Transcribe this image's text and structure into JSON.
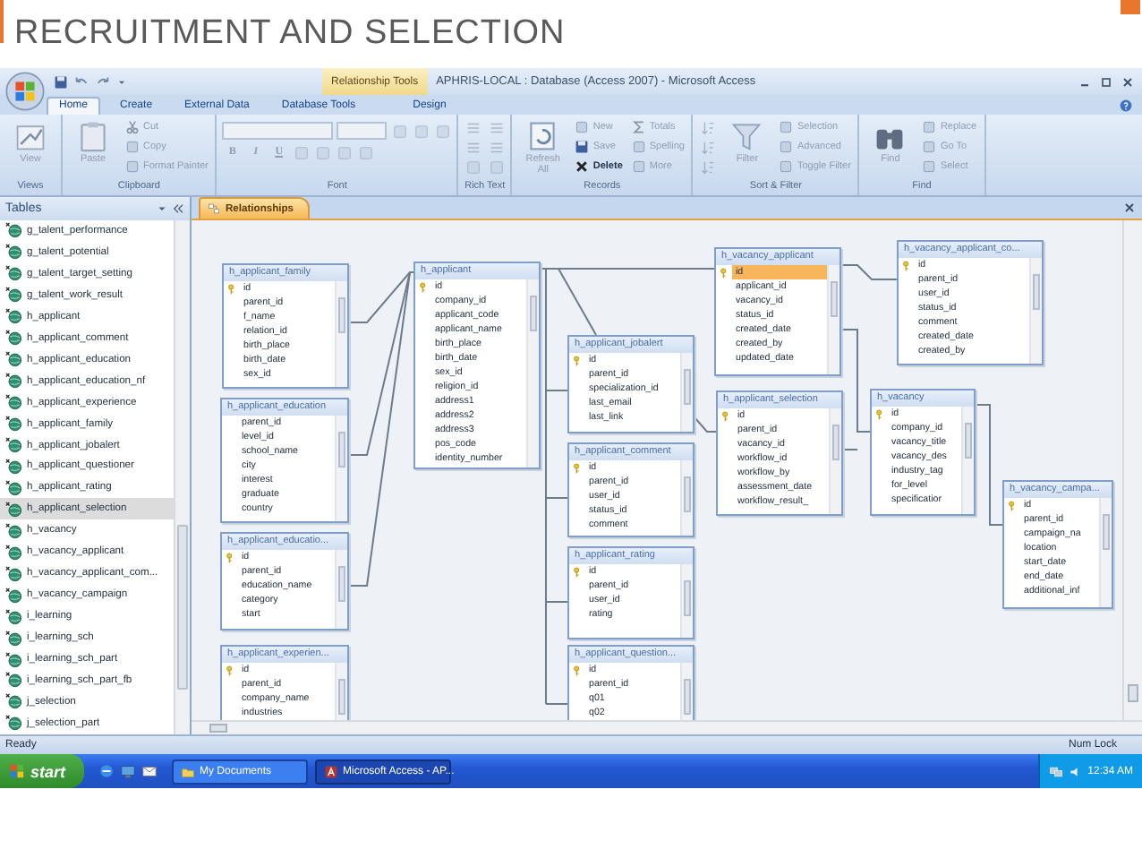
{
  "slide_title": "RECRUITMENT AND SELECTION",
  "window": {
    "context_tab": "Relationship Tools",
    "title": "APHRIS-LOCAL : Database (Access 2007) - Microsoft Access"
  },
  "ribbon_tabs": [
    {
      "label": "Home",
      "selected": true
    },
    {
      "label": "Create",
      "selected": false
    },
    {
      "label": "External Data",
      "selected": false
    },
    {
      "label": "Database Tools",
      "selected": false
    },
    {
      "label": "Design",
      "selected": false
    }
  ],
  "ribbon_groups": [
    {
      "label": "Views",
      "items": [
        {
          "kind": "large",
          "label": "View",
          "disabled": true
        }
      ]
    },
    {
      "label": "Clipboard",
      "items": [
        {
          "kind": "large",
          "label": "Paste",
          "disabled": true
        },
        {
          "kind": "small",
          "label": "Cut",
          "disabled": true
        },
        {
          "kind": "small",
          "label": "Copy",
          "disabled": true
        },
        {
          "kind": "small",
          "label": "Format Painter",
          "disabled": true
        }
      ]
    },
    {
      "label": "Font",
      "items": [
        {
          "kind": "field",
          "disabled": true
        },
        {
          "kind": "field",
          "disabled": true
        },
        {
          "kind": "icon",
          "disabled": true
        },
        {
          "kind": "icon",
          "disabled": true
        },
        {
          "kind": "icon",
          "disabled": true
        },
        {
          "kind": "glyph",
          "label": "B",
          "disabled": true
        },
        {
          "kind": "glyph",
          "label": "I",
          "disabled": true
        },
        {
          "kind": "glyph",
          "label": "U",
          "disabled": true
        },
        {
          "kind": "icon",
          "disabled": true
        },
        {
          "kind": "icon",
          "disabled": true
        },
        {
          "kind": "icon",
          "disabled": true
        },
        {
          "kind": "icon",
          "disabled": true
        }
      ]
    },
    {
      "label": "Rich Text",
      "items": [
        {
          "kind": "icon",
          "disabled": true
        },
        {
          "kind": "icon",
          "disabled": true
        },
        {
          "kind": "icon",
          "disabled": true
        },
        {
          "kind": "icon",
          "disabled": true
        },
        {
          "kind": "icon",
          "disabled": true
        },
        {
          "kind": "icon",
          "disabled": true
        }
      ]
    },
    {
      "label": "Records",
      "items": [
        {
          "kind": "large",
          "label": "Refresh All",
          "disabled": true
        },
        {
          "kind": "small",
          "label": "New",
          "disabled": true
        },
        {
          "kind": "small",
          "label": "Save",
          "disabled": true
        },
        {
          "kind": "small",
          "label": "Delete",
          "disabled": false
        },
        {
          "kind": "small",
          "label": "Totals",
          "disabled": true
        },
        {
          "kind": "small",
          "label": "Spelling",
          "disabled": true
        },
        {
          "kind": "small",
          "label": "More",
          "disabled": true
        }
      ]
    },
    {
      "label": "Sort & Filter",
      "items": [
        {
          "kind": "icon",
          "disabled": true
        },
        {
          "kind": "icon",
          "disabled": true
        },
        {
          "kind": "icon",
          "disabled": true
        },
        {
          "kind": "large",
          "label": "Filter",
          "disabled": true
        },
        {
          "kind": "small",
          "label": "Selection",
          "disabled": true
        },
        {
          "kind": "small",
          "label": "Advanced",
          "disabled": true
        },
        {
          "kind": "small",
          "label": "Toggle Filter",
          "disabled": true
        }
      ]
    },
    {
      "label": "Find",
      "items": [
        {
          "kind": "large",
          "label": "Find",
          "disabled": true
        },
        {
          "kind": "small",
          "label": "Replace",
          "disabled": true
        },
        {
          "kind": "small",
          "label": "Go To",
          "disabled": true
        },
        {
          "kind": "small",
          "label": "Select",
          "disabled": true
        }
      ]
    }
  ],
  "nav": {
    "header": "Tables",
    "items": [
      {
        "label": "g_talent_performance",
        "selected": false
      },
      {
        "label": "g_talent_potential",
        "selected": false
      },
      {
        "label": "g_talent_target_setting",
        "selected": false
      },
      {
        "label": "g_talent_work_result",
        "selected": false
      },
      {
        "label": "h_applicant",
        "selected": false
      },
      {
        "label": "h_applicant_comment",
        "selected": false
      },
      {
        "label": "h_applicant_education",
        "selected": false
      },
      {
        "label": "h_applicant_education_nf",
        "selected": false
      },
      {
        "label": "h_applicant_experience",
        "selected": false
      },
      {
        "label": "h_applicant_family",
        "selected": false
      },
      {
        "label": "h_applicant_jobalert",
        "selected": false
      },
      {
        "label": "h_applicant_questioner",
        "selected": false
      },
      {
        "label": "h_applicant_rating",
        "selected": false
      },
      {
        "label": "h_applicant_selection",
        "selected": true
      },
      {
        "label": "h_vacancy",
        "selected": false
      },
      {
        "label": "h_vacancy_applicant",
        "selected": false
      },
      {
        "label": "h_vacancy_applicant_com...",
        "selected": false
      },
      {
        "label": "h_vacancy_campaign",
        "selected": false
      },
      {
        "label": "i_learning",
        "selected": false
      },
      {
        "label": "i_learning_sch",
        "selected": false
      },
      {
        "label": "i_learning_sch_part",
        "selected": false
      },
      {
        "label": "i_learning_sch_part_fb",
        "selected": false
      },
      {
        "label": "j_selection",
        "selected": false
      },
      {
        "label": "j_selection_part",
        "selected": false
      }
    ]
  },
  "doc_tab": "Relationships",
  "tables": [
    {
      "title": "h_applicant_family",
      "fields": [
        {
          "name": "id",
          "key": true,
          "selected": false
        },
        {
          "name": "parent_id",
          "key": false,
          "selected": false
        },
        {
          "name": "f_name",
          "key": false,
          "selected": false
        },
        {
          "name": "relation_id",
          "key": false,
          "selected": false
        },
        {
          "name": "birth_place",
          "key": false,
          "selected": false
        },
        {
          "name": "birth_date",
          "key": false,
          "selected": false
        },
        {
          "name": "sex_id",
          "key": false,
          "selected": false
        }
      ]
    },
    {
      "title": "h_applicant_education",
      "fields": [
        {
          "name": "parent_id",
          "key": false,
          "selected": false
        },
        {
          "name": "level_id",
          "key": false,
          "selected": false
        },
        {
          "name": "school_name",
          "key": false,
          "selected": false
        },
        {
          "name": "city",
          "key": false,
          "selected": false
        },
        {
          "name": "interest",
          "key": false,
          "selected": false
        },
        {
          "name": "graduate",
          "key": false,
          "selected": false
        },
        {
          "name": "country",
          "key": false,
          "selected": false
        }
      ]
    },
    {
      "title": "h_applicant_educatio...",
      "fields": [
        {
          "name": "id",
          "key": true,
          "selected": false
        },
        {
          "name": "parent_id",
          "key": false,
          "selected": false
        },
        {
          "name": "education_name",
          "key": false,
          "selected": false
        },
        {
          "name": "category",
          "key": false,
          "selected": false
        },
        {
          "name": "start",
          "key": false,
          "selected": false
        }
      ]
    },
    {
      "title": "h_applicant_experien...",
      "fields": [
        {
          "name": "id",
          "key": true,
          "selected": false
        },
        {
          "name": "parent_id",
          "key": false,
          "selected": false
        },
        {
          "name": "company_name",
          "key": false,
          "selected": false
        },
        {
          "name": "industries",
          "key": false,
          "selected": false
        }
      ]
    },
    {
      "title": "h_applicant",
      "fields": [
        {
          "name": "id",
          "key": true,
          "selected": false
        },
        {
          "name": "company_id",
          "key": false,
          "selected": false
        },
        {
          "name": "applicant_code",
          "key": false,
          "selected": false
        },
        {
          "name": "applicant_name",
          "key": false,
          "selected": false
        },
        {
          "name": "birth_place",
          "key": false,
          "selected": false
        },
        {
          "name": "birth_date",
          "key": false,
          "selected": false
        },
        {
          "name": "sex_id",
          "key": false,
          "selected": false
        },
        {
          "name": "religion_id",
          "key": false,
          "selected": false
        },
        {
          "name": "address1",
          "key": false,
          "selected": false
        },
        {
          "name": "address2",
          "key": false,
          "selected": false
        },
        {
          "name": "address3",
          "key": false,
          "selected": false
        },
        {
          "name": "pos_code",
          "key": false,
          "selected": false
        },
        {
          "name": "identity_number",
          "key": false,
          "selected": false
        }
      ]
    },
    {
      "title": "h_applicant_jobalert",
      "fields": [
        {
          "name": "id",
          "key": true,
          "selected": false
        },
        {
          "name": "parent_id",
          "key": false,
          "selected": false
        },
        {
          "name": "specialization_id",
          "key": false,
          "selected": false
        },
        {
          "name": "last_email",
          "key": false,
          "selected": false
        },
        {
          "name": "last_link",
          "key": false,
          "selected": false
        }
      ]
    },
    {
      "title": "h_applicant_comment",
      "fields": [
        {
          "name": "id",
          "key": true,
          "selected": false
        },
        {
          "name": "parent_id",
          "key": false,
          "selected": false
        },
        {
          "name": "user_id",
          "key": false,
          "selected": false
        },
        {
          "name": "status_id",
          "key": false,
          "selected": false
        },
        {
          "name": "comment",
          "key": false,
          "selected": false
        }
      ]
    },
    {
      "title": "h_applicant_rating",
      "fields": [
        {
          "name": "id",
          "key": true,
          "selected": false
        },
        {
          "name": "parent_id",
          "key": false,
          "selected": false
        },
        {
          "name": "user_id",
          "key": false,
          "selected": false
        },
        {
          "name": "rating",
          "key": false,
          "selected": false
        }
      ]
    },
    {
      "title": "h_applicant_question...",
      "fields": [
        {
          "name": "id",
          "key": true,
          "selected": false
        },
        {
          "name": "parent_id",
          "key": false,
          "selected": false
        },
        {
          "name": "q01",
          "key": false,
          "selected": false
        },
        {
          "name": "q02",
          "key": false,
          "selected": false
        }
      ]
    },
    {
      "title": "h_vacancy_applicant",
      "fields": [
        {
          "name": "id",
          "key": true,
          "selected": true
        },
        {
          "name": "applicant_id",
          "key": false,
          "selected": false
        },
        {
          "name": "vacancy_id",
          "key": false,
          "selected": false
        },
        {
          "name": "status_id",
          "key": false,
          "selected": false
        },
        {
          "name": "created_date",
          "key": false,
          "selected": false
        },
        {
          "name": "created_by",
          "key": false,
          "selected": false
        },
        {
          "name": "updated_date",
          "key": false,
          "selected": false
        }
      ]
    },
    {
      "title": "h_vacancy_applicant_co...",
      "fields": [
        {
          "name": "id",
          "key": true,
          "selected": false
        },
        {
          "name": "parent_id",
          "key": false,
          "selected": false
        },
        {
          "name": "user_id",
          "key": false,
          "selected": false
        },
        {
          "name": "status_id",
          "key": false,
          "selected": false
        },
        {
          "name": "comment",
          "key": false,
          "selected": false
        },
        {
          "name": "created_date",
          "key": false,
          "selected": false
        },
        {
          "name": "created_by",
          "key": false,
          "selected": false
        }
      ]
    },
    {
      "title": "h_applicant_selection",
      "fields": [
        {
          "name": "id",
          "key": true,
          "selected": false
        },
        {
          "name": "parent_id",
          "key": false,
          "selected": false
        },
        {
          "name": "vacancy_id",
          "key": false,
          "selected": false
        },
        {
          "name": "workflow_id",
          "key": false,
          "selected": false
        },
        {
          "name": "workflow_by",
          "key": false,
          "selected": false
        },
        {
          "name": "assessment_date",
          "key": false,
          "selected": false
        },
        {
          "name": "workflow_result_",
          "key": false,
          "selected": false
        }
      ]
    },
    {
      "title": "h_vacancy",
      "fields": [
        {
          "name": "id",
          "key": true,
          "selected": false
        },
        {
          "name": "company_id",
          "key": false,
          "selected": false
        },
        {
          "name": "vacancy_title",
          "key": false,
          "selected": false
        },
        {
          "name": "vacancy_des",
          "key": false,
          "selected": false
        },
        {
          "name": "industry_tag",
          "key": false,
          "selected": false
        },
        {
          "name": "for_level",
          "key": false,
          "selected": false
        },
        {
          "name": "specificatior",
          "key": false,
          "selected": false
        }
      ]
    },
    {
      "title": "h_vacancy_campa...",
      "fields": [
        {
          "name": "id",
          "key": true,
          "selected": false
        },
        {
          "name": "parent_id",
          "key": false,
          "selected": false
        },
        {
          "name": "campaign_na",
          "key": false,
          "selected": false
        },
        {
          "name": "location",
          "key": false,
          "selected": false
        },
        {
          "name": "start_date",
          "key": false,
          "selected": false
        },
        {
          "name": "end_date",
          "key": false,
          "selected": false
        },
        {
          "name": "additional_inf",
          "key": false,
          "selected": false
        }
      ]
    }
  ],
  "status_bar": {
    "left": "Ready",
    "right": "Num Lock"
  },
  "taskbar": {
    "start": "start",
    "buttons": [
      {
        "label": "My Documents",
        "selected": false
      },
      {
        "label": "Microsoft Access - AP...",
        "selected": true
      }
    ],
    "clock": "12:34 AM"
  }
}
